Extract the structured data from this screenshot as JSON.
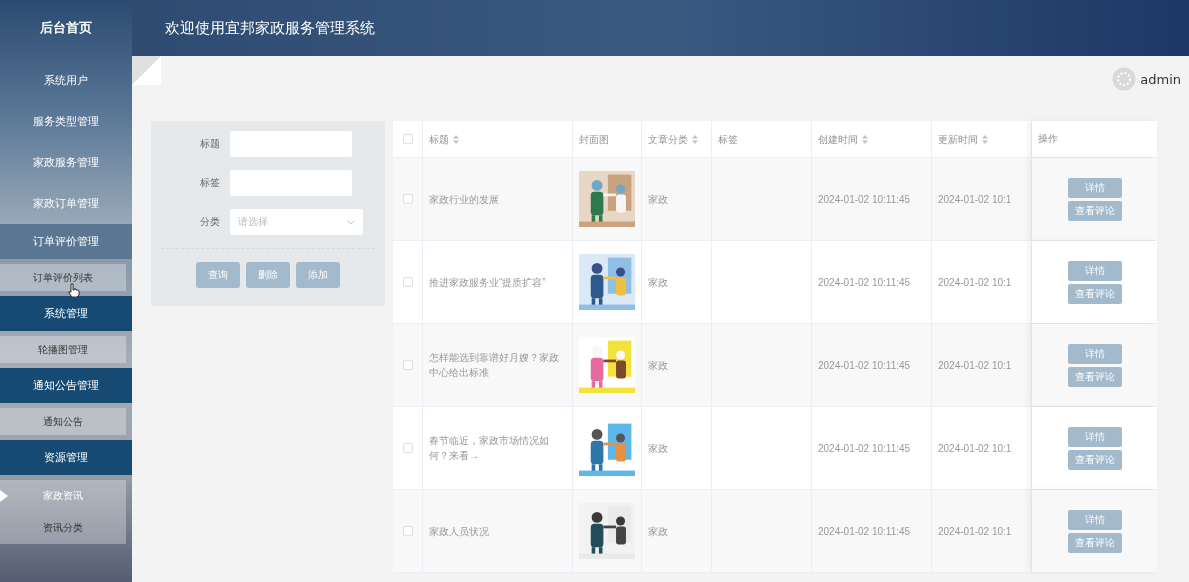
{
  "sidebar": {
    "home": "后台首页",
    "items": [
      {
        "label": "系统用户",
        "expanded": false
      },
      {
        "label": "服务类型管理",
        "expanded": false
      },
      {
        "label": "家政服务管理",
        "expanded": false
      },
      {
        "label": "家政订单管理",
        "expanded": false
      },
      {
        "label": "订单评价管理",
        "expanded": true,
        "focused": true,
        "children": [
          {
            "label": "订单评价列表",
            "selected": false
          }
        ]
      },
      {
        "label": "系统管理",
        "expanded": true,
        "focused": false,
        "children": [
          {
            "label": "轮播图管理",
            "selected": false
          }
        ]
      },
      {
        "label": "通知公告管理",
        "expanded": true,
        "focused": false,
        "children": [
          {
            "label": "通知公告",
            "selected": false
          }
        ]
      },
      {
        "label": "资源管理",
        "expanded": true,
        "focused": false,
        "children": [
          {
            "label": "家政资讯",
            "selected": true
          },
          {
            "label": "资讯分类",
            "selected": false
          }
        ]
      }
    ]
  },
  "header": {
    "title": "欢迎使用宜邦家政服务管理系统",
    "user": "admin"
  },
  "search": {
    "fields": [
      {
        "label": "标题",
        "kind": "input"
      },
      {
        "label": "标签",
        "kind": "input"
      },
      {
        "label": "分类",
        "kind": "select",
        "placeholder": "请选择"
      }
    ],
    "buttons": [
      "查询",
      "删除",
      "添加"
    ]
  },
  "table": {
    "columns": [
      {
        "kind": "check",
        "checked": false
      },
      {
        "label": "标题",
        "sortable": true
      },
      {
        "label": "封面图",
        "sortable": false
      },
      {
        "label": "文章分类",
        "sortable": true
      },
      {
        "label": "标签",
        "sortable": false
      },
      {
        "label": "创建时间",
        "sortable": true
      },
      {
        "label": "更新时间",
        "sortable": true
      },
      {
        "label": "操作",
        "sortable": false
      }
    ],
    "rows": [
      {
        "checked": false,
        "title": "家政行业的发展",
        "cover": {
          "kind": "picture"
        },
        "category": "家政",
        "created": "2024-01-02 10:11:45",
        "updated": "2024-01-02 10:1",
        "actions": [
          "详情",
          "查看评论"
        ]
      },
      {
        "checked": false,
        "title": "推进家政服务业“提质扩容”",
        "cover": {
          "kind": "picture"
        },
        "category": "家政",
        "created": "2024-01-02 10:11:45",
        "updated": "2024-01-02 10:1",
        "actions": [
          "详情",
          "查看评论"
        ]
      },
      {
        "checked": false,
        "title": "怎样能选到靠谱好月嫂？家政中心给出标准",
        "cover": {
          "kind": "picture"
        },
        "category": "家政",
        "created": "2024-01-02 10:11:45",
        "updated": "2024-01-02 10:1",
        "actions": [
          "详情",
          "查看评论"
        ]
      },
      {
        "checked": false,
        "title": "春节临近，家政市场情况如何？来看→",
        "cover": {
          "kind": "picture"
        },
        "category": "家政",
        "created": "2024-01-02 10:11:45",
        "updated": "2024-01-02 10:1",
        "actions": [
          "详情",
          "查看评论"
        ]
      },
      {
        "checked": false,
        "title": "家政人员状况",
        "cover": {
          "kind": "picture"
        },
        "category": "家政",
        "created": "2024-01-02 10:11:45",
        "updated": "2024-01-02 10:1",
        "actions": [
          "详情",
          "查看评论"
        ]
      }
    ]
  }
}
